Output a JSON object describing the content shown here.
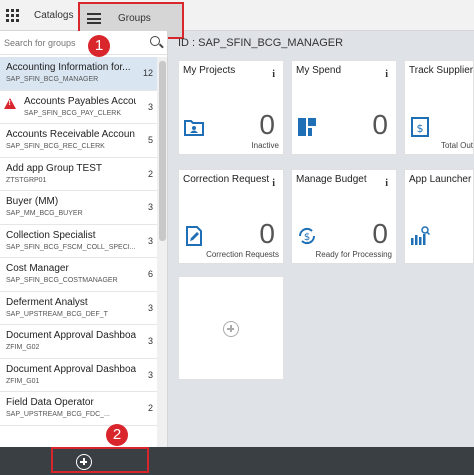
{
  "header": {
    "catalogs_label": "Catalogs",
    "groups_label": "Groups"
  },
  "callouts": [
    "1",
    "2"
  ],
  "search": {
    "placeholder": "Search for groups"
  },
  "groups": [
    {
      "title": "Accounting Information for...",
      "id": "SAP_SFIN_BCG_MANAGER",
      "count": "12",
      "selected": true
    },
    {
      "title": "Accounts Payables Accou...",
      "id": "SAP_SFIN_BCG_PAY_CLERK",
      "count": "3",
      "warning": true
    },
    {
      "title": "Accounts Receivable Accoun...",
      "id": "SAP_SFIN_BCG_REC_CLERK",
      "count": "5"
    },
    {
      "title": "Add app Group TEST",
      "id": "ZTSTGRP01",
      "count": "2"
    },
    {
      "title": "Buyer (MM)",
      "id": "SAP_MM_BCG_BUYER",
      "count": "3"
    },
    {
      "title": "Collection Specialist",
      "id": "SAP_SFIN_BCG_FSCM_COLL_SPECI...",
      "count": "3"
    },
    {
      "title": "Cost Manager",
      "id": "SAP_SFIN_BCG_COSTMANAGER",
      "count": "6"
    },
    {
      "title": "Deferment Analyst",
      "id": "SAP_UPSTREAM_BCG_DEF_T",
      "count": "3"
    },
    {
      "title": "Document Approval Dashboard",
      "id": "ZFIM_G02",
      "count": "3"
    },
    {
      "title": "Document Approval Dashboard",
      "id": "ZFIM_G01",
      "count": "3"
    },
    {
      "title": "Field Data Operator",
      "id": "SAP_UPSTREAM_BCG_FDC_...",
      "count": "2"
    }
  ],
  "main": {
    "group_id_label": "ID : SAP_SFIN_BCG_MANAGER",
    "tiles": [
      {
        "title": "My Projects",
        "number": "0",
        "footer": "Inactive",
        "icon": "folder-icon"
      },
      {
        "title": "My Spend",
        "number": "0",
        "footer": "",
        "icon": "dashboard-icon"
      },
      {
        "title": "Track Supplier In",
        "number": "",
        "footer": "Total Out",
        "icon": "invoice-icon"
      },
      {
        "title": "Correction Request",
        "number": "0",
        "footer": "Correction Requests",
        "icon": "edit-document-icon"
      },
      {
        "title": "Manage Budget",
        "number": "0",
        "footer": "Ready for Processing",
        "icon": "sync-money-icon"
      },
      {
        "title": "App Launcher –",
        "number": "",
        "footer": "",
        "icon": "bar-chart-search-icon"
      }
    ],
    "info_glyph": "i"
  },
  "colors": {
    "accent": "#1e6fb5",
    "highlight": "#d9262c",
    "selected_row": "#d9e6f2",
    "bottom_bar": "#3a3f44"
  }
}
